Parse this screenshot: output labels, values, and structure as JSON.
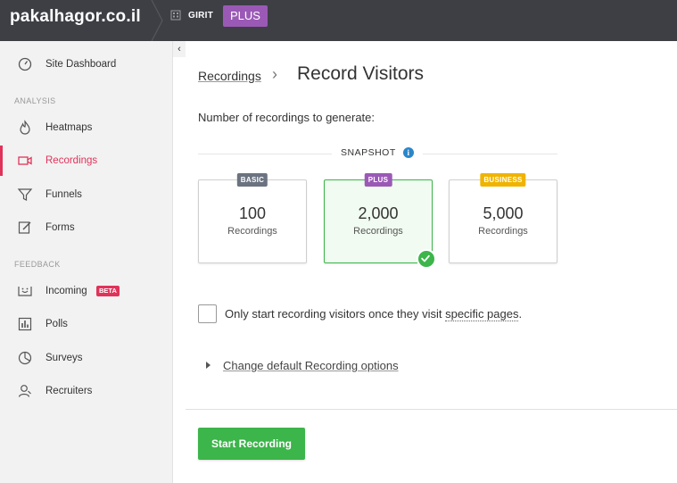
{
  "header": {
    "site_name": "pakalhagor.co.il",
    "org_name": "GIRIT",
    "plan": "PLUS"
  },
  "sidebar": {
    "collapse_glyph": "‹",
    "dashboard": "Site Dashboard",
    "analysis_label": "ANALYSIS",
    "analysis_items": [
      {
        "label": "Heatmaps",
        "icon": "flame-icon"
      },
      {
        "label": "Recordings",
        "icon": "video-camera-icon",
        "active": true
      },
      {
        "label": "Funnels",
        "icon": "funnel-icon"
      },
      {
        "label": "Forms",
        "icon": "form-edit-icon"
      }
    ],
    "feedback_label": "FEEDBACK",
    "feedback_items": [
      {
        "label": "Incoming",
        "icon": "inbox-face-icon",
        "badge": "BETA"
      },
      {
        "label": "Polls",
        "icon": "bar-chart-icon"
      },
      {
        "label": "Surveys",
        "icon": "pie-chart-icon"
      },
      {
        "label": "Recruiters",
        "icon": "user-icon"
      }
    ]
  },
  "main": {
    "breadcrumb_link": "Recordings",
    "breadcrumb_sep": "›",
    "title": "Record Visitors",
    "subtitle": "Number of recordings to generate:",
    "snapshot_label": "SNAPSHOT",
    "info_glyph": "i",
    "cards": [
      {
        "tier": "BASIC",
        "tier_color": "#6b7380",
        "amount": "100",
        "unit": "Recordings",
        "selected": false
      },
      {
        "tier": "PLUS",
        "tier_color": "#9b59b6",
        "amount": "2,000",
        "unit": "Recordings",
        "selected": true
      },
      {
        "tier": "BUSINESS",
        "tier_color": "#f0b400",
        "amount": "5,000",
        "unit": "Recordings",
        "selected": false
      }
    ],
    "checkbox_text_before": "Only start recording visitors once they visit ",
    "checkbox_text_link": "specific pages",
    "checkbox_text_after": ".",
    "options_link": "Change default Recording options",
    "start_button": "Start Recording"
  },
  "colors": {
    "accent_active": "#e0335a",
    "success": "#3cb54a",
    "topbar": "#3d3f45"
  }
}
